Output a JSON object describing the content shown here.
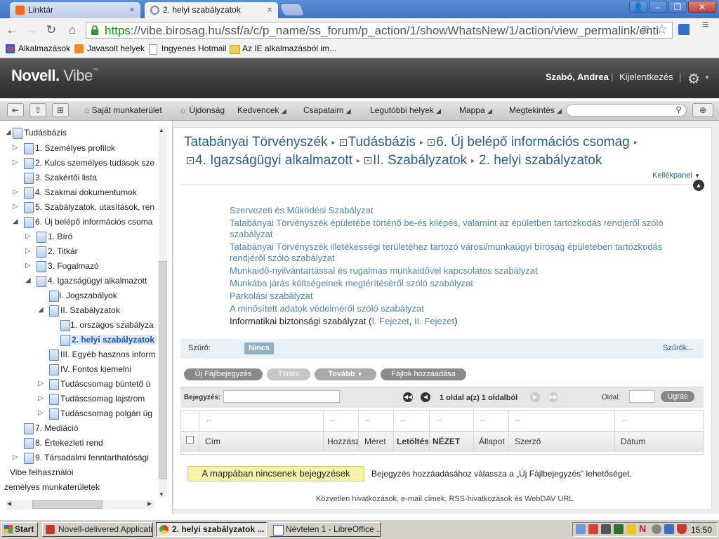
{
  "browser": {
    "tabs": [
      {
        "title": "Linktár"
      },
      {
        "title": "2. helyi szabályzatok"
      }
    ],
    "url_scheme": "https",
    "url_rest": "://vibe.birosag.hu/ssf/a/c/p_name/ss_forum/p_action/1/showWhatsNew/1/action/view_permalink/enti",
    "bookmarks": [
      "Alkalmazások",
      "Javasolt helyek",
      "Ingyenes Hotmail",
      "Az IE alkalmazásból im..."
    ]
  },
  "app": {
    "logo_novell": "Novell.",
    "logo_vibe": "Vibe",
    "user_name": "Szabó, Andrea",
    "logout": "Kijelentkezés",
    "sep": "|"
  },
  "nav": {
    "items": [
      "Saját munkaterület",
      "Újdonság",
      "Kedvencek",
      "Csapataim",
      "Legutóbbi helyek",
      "Mappa",
      "Megtekintés"
    ]
  },
  "tree": [
    {
      "label": "Tudásbázis"
    },
    {
      "label": "1. Személyes profilok"
    },
    {
      "label": "2. Kulcs személyes tudások sze"
    },
    {
      "label": "3. Szakértői lista"
    },
    {
      "label": "4. Szakmai dokumentumok"
    },
    {
      "label": "5. Szabályzatok, utasítások, ren"
    },
    {
      "label": "6. Új belépő információs csoma"
    },
    {
      "label": "1. Bíró"
    },
    {
      "label": "2. Titkár"
    },
    {
      "label": "3. Fogalmazó"
    },
    {
      "label": "4. Igazságügyi alkalmazott"
    },
    {
      "label": "I. Jogszabályok"
    },
    {
      "label": "II. Szabályzatok"
    },
    {
      "label": "1. országos szabályza"
    },
    {
      "label": "2. helyi szabályzatok"
    },
    {
      "label": "III. Egyéb hasznos inform"
    },
    {
      "label": "IV. Fontos kiemelni"
    },
    {
      "label": "Tudáscsomag büntető ü"
    },
    {
      "label": "Tudáscsomag lajstrom"
    },
    {
      "label": "Tudáscsomag polgári üg"
    },
    {
      "label": "7. Mediáció"
    },
    {
      "label": "8. Értekezleti rend"
    },
    {
      "label": "9. Társadalmi fenntarthatósági"
    },
    {
      "label": "Vibe felhasználói"
    },
    {
      "label": "zemélyes munkaterületek"
    }
  ],
  "breadcrumb": {
    "c1": "Tatabányai Törvényszék",
    "c2": "Tudásbázis",
    "c3": "6. Új belépő információs csomag",
    "c4": "4. Igazságügyi alkalmazott",
    "c5": "II. Szabályzatok",
    "c6": "2. helyi szabályzatok",
    "toolpanel": "Kellékpanel"
  },
  "folders": [
    {
      "text": "Szervezeti és Működési Szabályzat"
    },
    {
      "text": "Tatabányai Törvényszék épületébe történő be-és kilépés, valamint az épületben tartózkodás rendjéről szóló szabályzat"
    },
    {
      "text": "Tatabányai Törvényszék illetékességi területéhez tartozó városi/munkaügyi bíróság épületében tartózkodás rendjéről szóló szabályzat"
    },
    {
      "text": "Munkaidő-nyilvántartással és rugalmas munkaidővel kapcsolatos szabályzat"
    },
    {
      "text": "Munkába járás költségeinek megtérítéséről szóló szabályzat"
    },
    {
      "text": "Parkolási szabályzat"
    },
    {
      "text": "A minősített adatok védelméről szóló szabályzat"
    }
  ],
  "infosec": {
    "text": "Informatikai biztonsági szabályzat (",
    "link1": "I. Fejezet",
    "comma": ", ",
    "link2": "II. Fejezet",
    "close": ")"
  },
  "filter": {
    "label": "Szűrő:",
    "value": "Nincs",
    "filters_link": "Szűrők..."
  },
  "actions": {
    "new_file": "Új Fájlbejegyzés",
    "delete": "Törlés",
    "more": "Tovább",
    "add_files": "Fájlok hozzáadása"
  },
  "pager": {
    "entry_label": "Bejegyzés:",
    "info": "1 oldal a(z) 1 oldalból",
    "page_label": "Oldal:",
    "go": "Ugrás"
  },
  "table": {
    "columns": [
      "Cím",
      "Hozzászólás",
      "Méret",
      "Letöltések",
      "NÉZET",
      "Állapot",
      "Szerző",
      "Dátum"
    ],
    "resize_glyph": "↔"
  },
  "empty": {
    "message": "A mappában nincsenek bejegyzések",
    "hint": "Bejegyzés hozzáadásához válassza a „Új Fájlbejegyzés” lehetőséget."
  },
  "footer": "Közvetlen hivatkozások, e-mail címek, RSS-hivatkozások és WebDAV URL",
  "taskbar": {
    "start": "Start",
    "tasks": [
      "Novell-delivered Applicati...",
      "2. helyi szabályzatok ...",
      "Névtelen 1 - LibreOffice ..."
    ],
    "clock": "15:50"
  },
  "colors": {
    "link": "#4a86b5",
    "crumb": "#2a5d87",
    "header_bg": "#3a3a3a",
    "empty_bg": "#f6f3a8"
  }
}
